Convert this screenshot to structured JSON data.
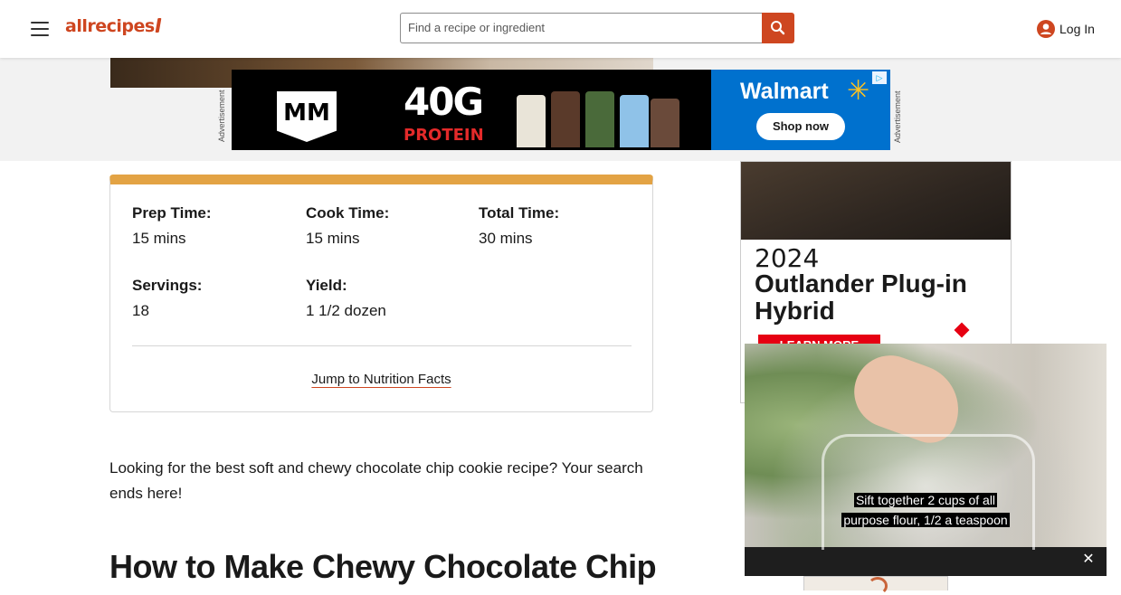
{
  "header": {
    "logo_text": "allrecipes",
    "search_placeholder": "Find a recipe or ingredient",
    "login_label": "Log In",
    "brand_color": "#ce4620",
    "icons": [
      "menu-icon",
      "search-icon",
      "user-icon"
    ]
  },
  "ad_strip": {
    "tag_left": "Advertisement",
    "tag_right": "Advertisement",
    "banner": {
      "brand_logo": "MM",
      "headline": "40G",
      "subheadline": "PROTEIN",
      "retailer": "Walmart",
      "retailer_color": "#0071ce",
      "cta": "Shop now"
    }
  },
  "recipe_details": {
    "accent_color": "#e3a344",
    "items": [
      {
        "label": "Prep Time:",
        "value": "15 mins"
      },
      {
        "label": "Cook Time:",
        "value": "15 mins"
      },
      {
        "label": "Total Time:",
        "value": "30 mins"
      },
      {
        "label": "Servings:",
        "value": "18"
      },
      {
        "label": "Yield:",
        "value": "1 1/2 dozen"
      }
    ],
    "jump_link": "Jump to Nutrition Facts"
  },
  "article": {
    "intro": "Looking for the best soft and chewy chocolate chip cookie recipe? Your search ends here!",
    "heading": "How to Make Chewy Chocolate Chip"
  },
  "side_ad": {
    "year": "2024",
    "title_line1": "Outlander Plug-in",
    "title_line2": "Hybrid",
    "cta": "LEARN MORE",
    "accent_color": "#e60012"
  },
  "video_player": {
    "caption_line1": "Sift together 2 cups of all",
    "caption_line2": "purpose flour, 1/2 a teaspoon",
    "close_label": "✕"
  }
}
